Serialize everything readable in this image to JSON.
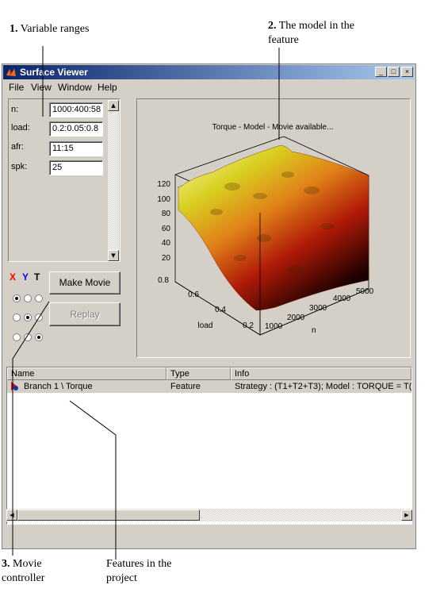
{
  "callouts": {
    "c1": {
      "num": "1.",
      "text": " Variable ranges"
    },
    "c2": {
      "num": "2.",
      "text1": " The model in the",
      "text2": "feature"
    },
    "c3": {
      "num": "3.",
      "text1": " Movie",
      "text2": "controller"
    },
    "c4": {
      "text1": "Features in the",
      "text2": "project"
    }
  },
  "window": {
    "title": "Surface Viewer",
    "controls": {
      "minimize": "_",
      "maximize": "□",
      "close": "×"
    },
    "menu": [
      "File",
      "View",
      "Window",
      "Help"
    ]
  },
  "variables": [
    {
      "label": "n:",
      "value": "1000:400:58"
    },
    {
      "label": "load:",
      "value": "0.2:0.05:0.8"
    },
    {
      "label": "afr:",
      "value": "11:15"
    },
    {
      "label": "spk:",
      "value": "25"
    }
  ],
  "movie": {
    "axis_labels": {
      "x": "X",
      "y": "Y",
      "t": "T"
    },
    "x_color": "#ff0000",
    "y_color": "#0000ff",
    "make_movie": "Make Movie",
    "replay": "Replay",
    "radio_rows": [
      [
        "on",
        "off",
        "off"
      ],
      [
        "off",
        "on",
        "off"
      ],
      [
        "off",
        "off",
        "on"
      ]
    ]
  },
  "plot": {
    "title": "Torque - Model - Movie available...",
    "z_ticks": [
      "20",
      "40",
      "60",
      "80",
      "100",
      "120"
    ],
    "load_ticks": [
      "0.2",
      "0.4",
      "0.6",
      "0.8"
    ],
    "n_ticks": [
      "1000",
      "2000",
      "3000",
      "4000",
      "5000"
    ],
    "load_label": "load",
    "n_label": "n"
  },
  "list": {
    "columns": [
      "Name",
      "Type",
      "Info"
    ],
    "rows": [
      {
        "name": "Branch 1 \\ Torque",
        "type": "Feature",
        "info": "Strategy : (T1+T2+T3);   Model : TORQUE = T("
      }
    ]
  }
}
